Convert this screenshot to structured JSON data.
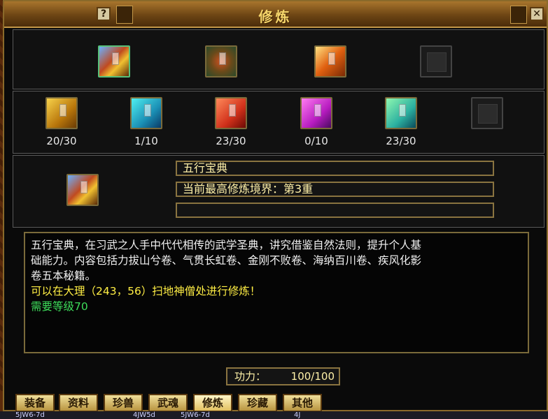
{
  "window": {
    "title": "修炼",
    "help_label": "?",
    "close_label": "✕"
  },
  "top_slots": [
    {
      "icon": "five-elements-book-stack-icon",
      "selected": true
    },
    {
      "icon": "scroll-bundle-icon",
      "selected": false
    },
    {
      "icon": "golden-scroll-bundle-icon",
      "selected": false
    },
    {
      "icon": "empty-slot-icon",
      "selected": false
    }
  ],
  "volumes": [
    {
      "icon": "yellow-book-icon",
      "count": "20/30"
    },
    {
      "icon": "cyan-book-icon",
      "count": "1/10"
    },
    {
      "icon": "red-book-icon",
      "count": "23/30"
    },
    {
      "icon": "purple-book-icon",
      "count": "0/10"
    },
    {
      "icon": "green-book-icon",
      "count": "23/30"
    },
    {
      "icon": "empty-slot-icon",
      "count": ""
    }
  ],
  "detail": {
    "name": "五行宝典",
    "realm": "当前最高修炼境界：第3重",
    "extra": ""
  },
  "description": {
    "line1": "五行宝典，在习武之人手中代代相传的武学圣典，讲究借鉴自然法则，提升个人基",
    "line2": "础能力。内容包括力拔山兮卷、气贯长虹卷、金刚不败卷、海纳百川卷、疾风化影",
    "line3": "卷五本秘籍。",
    "location": "可以在大理（243，56）扫地神僧处进行修炼！",
    "requirement": "需要等级70"
  },
  "power": {
    "label": "功力：",
    "value": "100/100"
  },
  "tabs": [
    "装备",
    "资料",
    "珍兽",
    "武魂",
    "修炼",
    "珍藏",
    "其他"
  ],
  "active_tab": "修炼",
  "bottom_strip": [
    "5JW6-7d",
    "4JW5d",
    "5JW6-7d",
    "4J"
  ]
}
